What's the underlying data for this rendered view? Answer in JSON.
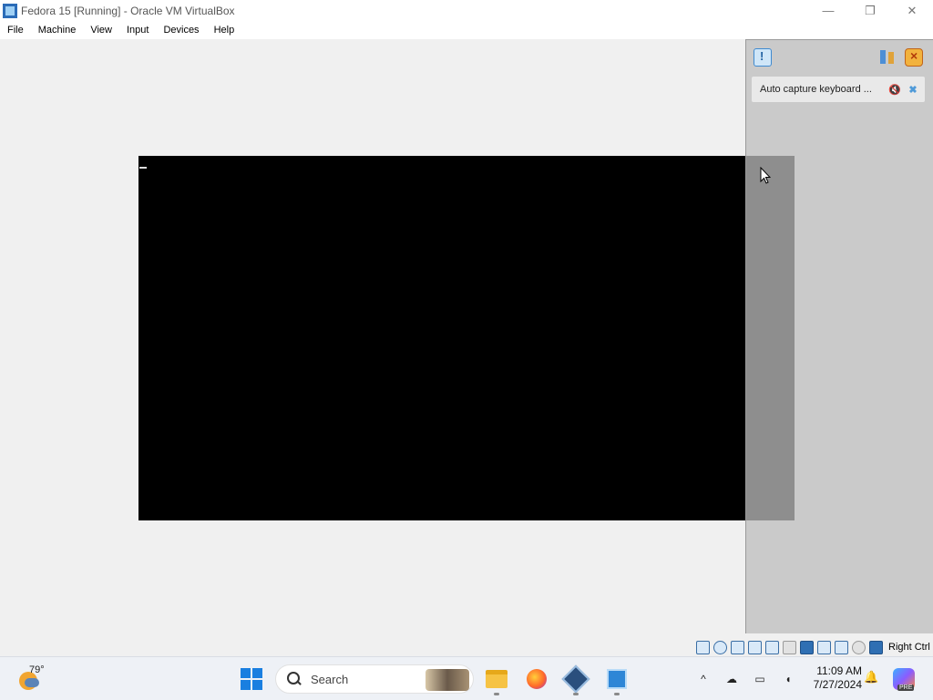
{
  "window": {
    "title": "Fedora 15 [Running] - Oracle VM VirtualBox",
    "minimize_glyph": "—",
    "restore_glyph": "❐",
    "close_glyph": "✕"
  },
  "menu": {
    "items": [
      "File",
      "Machine",
      "View",
      "Input",
      "Devices",
      "Help"
    ]
  },
  "notification_panel": {
    "notification_text": "Auto capture keyboard ...",
    "mute_glyph": "🔇",
    "close_glyph": "✖"
  },
  "statusbar": {
    "host_key": "Right Ctrl"
  },
  "taskbar": {
    "weather_temp": "79°",
    "search_placeholder": "Search",
    "time": "11:09 AM",
    "date": "7/27/2024",
    "chevron_glyph": "^",
    "copilot_badge": "PRE"
  }
}
